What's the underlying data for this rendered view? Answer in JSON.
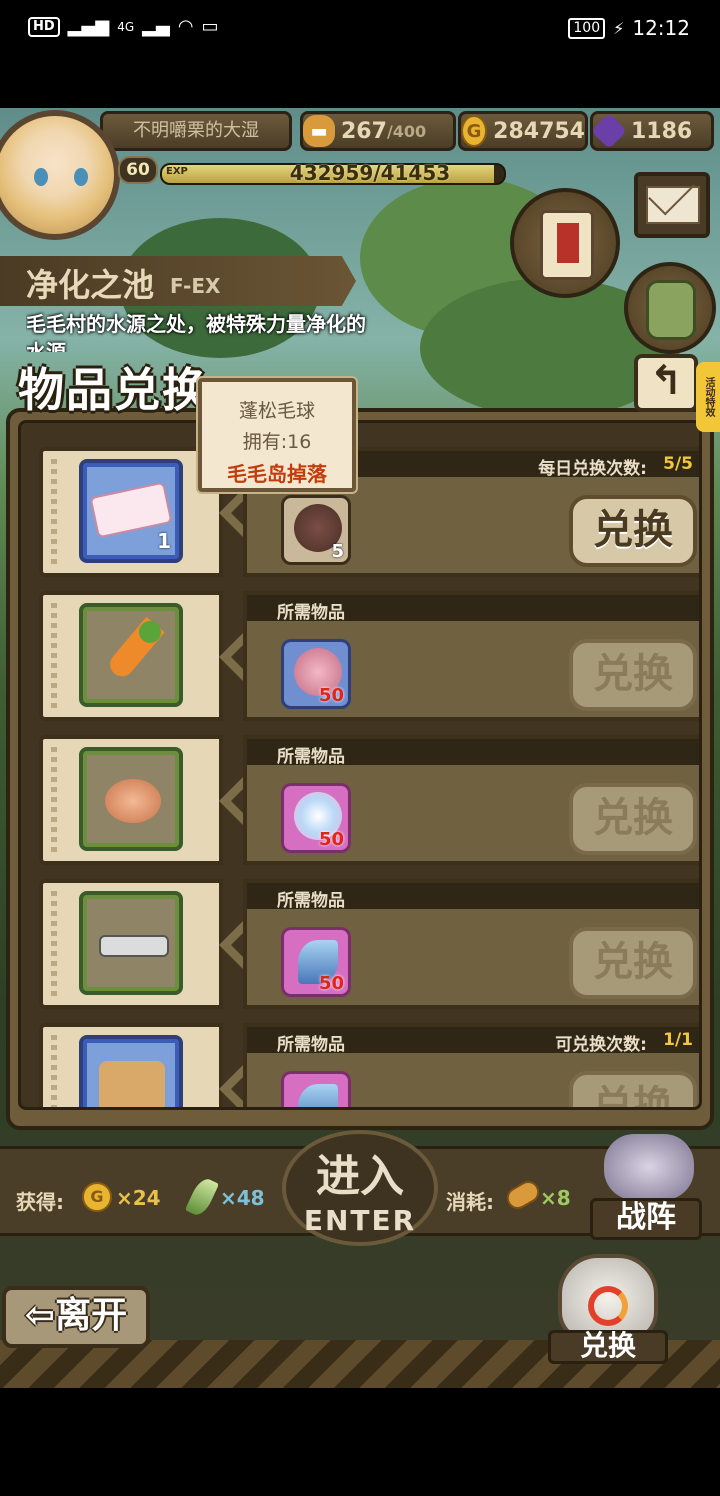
{
  "status_bar": {
    "network_chip": "HD",
    "network_type": "4G",
    "battery": "100",
    "time": "12:12"
  },
  "player": {
    "name": "不明嚼栗的大湿",
    "level": "60",
    "exp_label": "EXP",
    "exp_text": "432959/41453",
    "exp_fraction": 0.97
  },
  "resources": {
    "stamina": "267",
    "stamina_max": "/400",
    "gold": "284754",
    "gems": "1186"
  },
  "stage": {
    "name": "净化之池",
    "code": "F-EX",
    "description": "毛毛村的水源之处，被特殊力量净化的水源"
  },
  "panel": {
    "title": "物品兑换",
    "side_tag": "活动特效",
    "back_icon": "↰",
    "rows": [
      {
        "req_label": "",
        "count_label": "每日兑换次数:",
        "count_value": "5/5",
        "reward_qty": "1",
        "req_qty": "5",
        "button": "兑换"
      },
      {
        "req_label": "所需物品",
        "count_label": "",
        "count_value": "",
        "reward_qty": "",
        "req_qty": "50",
        "button": "兑换"
      },
      {
        "req_label": "所需物品",
        "count_label": "",
        "count_value": "",
        "reward_qty": "",
        "req_qty": "50",
        "button": "兑换"
      },
      {
        "req_label": "所需物品",
        "count_label": "",
        "count_value": "",
        "reward_qty": "",
        "req_qty": "50",
        "button": "兑换"
      },
      {
        "req_label": "所需物品",
        "count_label": "可兑换次数:",
        "count_value": "1/1",
        "reward_qty": "",
        "req_qty": "",
        "button": "兑换"
      }
    ]
  },
  "tooltip": {
    "item_name": "蓬松毛球",
    "owned": "拥有:16",
    "source": "毛毛岛掉落"
  },
  "bottom": {
    "gain_label": "获得:",
    "gain_gold": "×24",
    "gain_feather": "×48",
    "cost_label": "消耗:",
    "cost_bread": "×8",
    "enter_cn": "进入",
    "enter_en": "ENTER",
    "lineup": "战阵",
    "leave": "⇦离开",
    "exchange": "兑换"
  },
  "colors": {
    "accent_gold": "#f0c93a",
    "tooltip_source": "#c23c0c",
    "qty_red": "#e0261c"
  }
}
